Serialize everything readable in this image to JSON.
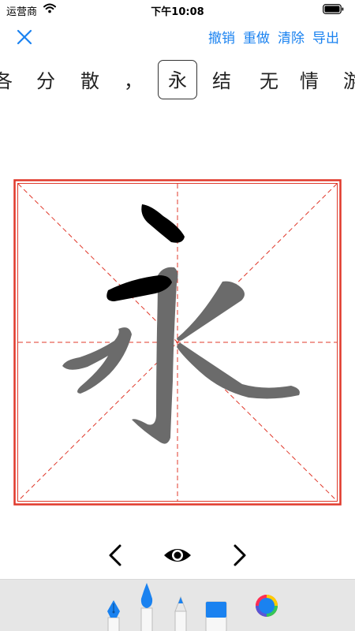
{
  "status_bar": {
    "carrier": "运营商",
    "time": "下午10:08"
  },
  "nav": {
    "undo_label": "撤销",
    "redo_label": "重做",
    "clear_label": "清除",
    "export_label": "导出"
  },
  "text_strip": {
    "chars": [
      "各",
      "分",
      "散",
      "，",
      "永",
      "结",
      "无",
      "情",
      "游"
    ],
    "current_index": 4
  },
  "practice": {
    "character": "永"
  },
  "colors": {
    "accent": "#1a82f0",
    "grid_border": "#e0392b",
    "grid_dash": "#e0392b",
    "guide_glyph": "#6b6b6b",
    "stroke_ink": "#000000",
    "tray_background": "#e6e6e6"
  },
  "icons": {
    "close": "close-icon",
    "prev": "chevron-left-icon",
    "toggle_guide": "eye-icon",
    "next": "chevron-right-icon",
    "tools": [
      "fountain-pen-icon",
      "brush-icon",
      "pencil-icon",
      "marker-icon",
      "color-picker-icon"
    ]
  }
}
